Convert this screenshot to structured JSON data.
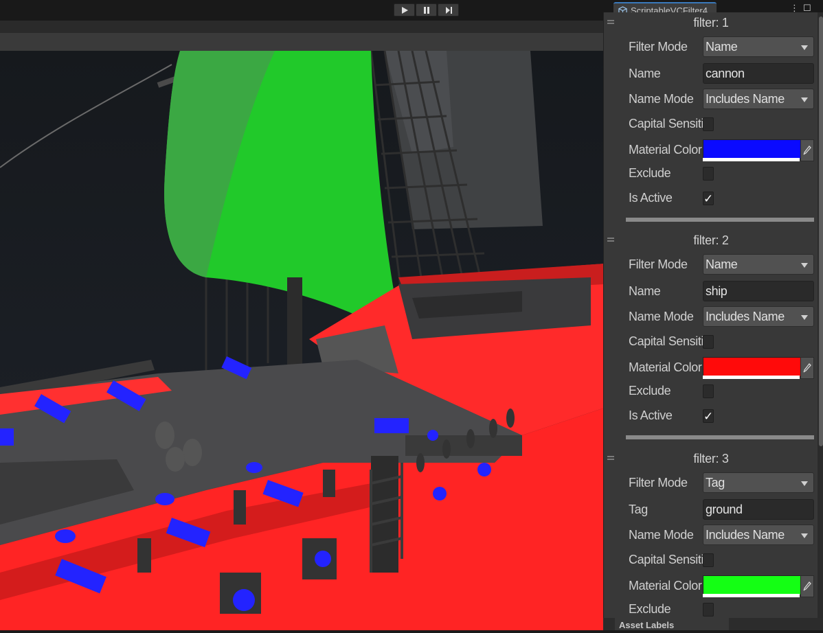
{
  "toolbar": {
    "play_icon": "play-icon",
    "pause_icon": "pause-icon",
    "step_icon": "step-icon"
  },
  "window": {
    "tab_title": "ScriptableVCFilter4",
    "tab_icon": "scriptable-object-icon",
    "menu_icon": "kebab-menu-icon",
    "maximize_icon": "maximize-icon"
  },
  "filters": [
    {
      "title": "filter: 1",
      "filter_mode_label": "Filter Mode",
      "filter_mode_value": "Name",
      "name_label": "Name",
      "name_value": "cannon",
      "name_mode_label": "Name Mode",
      "name_mode_value": "Includes Name",
      "capital_label": "Capital Sensitive",
      "capital_checked": false,
      "material_color_label": "Material Color",
      "material_color": "#0a0aff",
      "exclude_label": "Exclude",
      "exclude_checked": false,
      "is_active_label": "Is Active",
      "is_active_checked": true,
      "check_glyph": "✓"
    },
    {
      "title": "filter: 2",
      "filter_mode_label": "Filter Mode",
      "filter_mode_value": "Name",
      "name_label": "Name",
      "name_value": "ship",
      "name_mode_label": "Name Mode",
      "name_mode_value": "Includes Name",
      "capital_label": "Capital Sensitive",
      "capital_checked": false,
      "material_color_label": "Material Color",
      "material_color": "#ff0a0a",
      "exclude_label": "Exclude",
      "exclude_checked": false,
      "is_active_label": "Is Active",
      "is_active_checked": true,
      "check_glyph": "✓"
    },
    {
      "title": "filter: 3",
      "filter_mode_label": "Filter Mode",
      "filter_mode_value": "Tag",
      "name_label": "Tag",
      "name_value": "ground",
      "name_mode_label": "Name Mode",
      "name_mode_value": "Includes Name",
      "capital_label": "Capital Sensitive",
      "capital_checked": false,
      "material_color_label": "Material Color",
      "material_color": "#14ff14",
      "exclude_label": "Exclude",
      "exclude_checked": false
    }
  ],
  "footer": {
    "asset_labels": "Asset Labels"
  },
  "colors": {
    "ship_hull": "#ff2626",
    "sail_green": "#1fd12a",
    "cannon_blue": "#2222ff",
    "deck_gray": "#4a4a4c"
  }
}
